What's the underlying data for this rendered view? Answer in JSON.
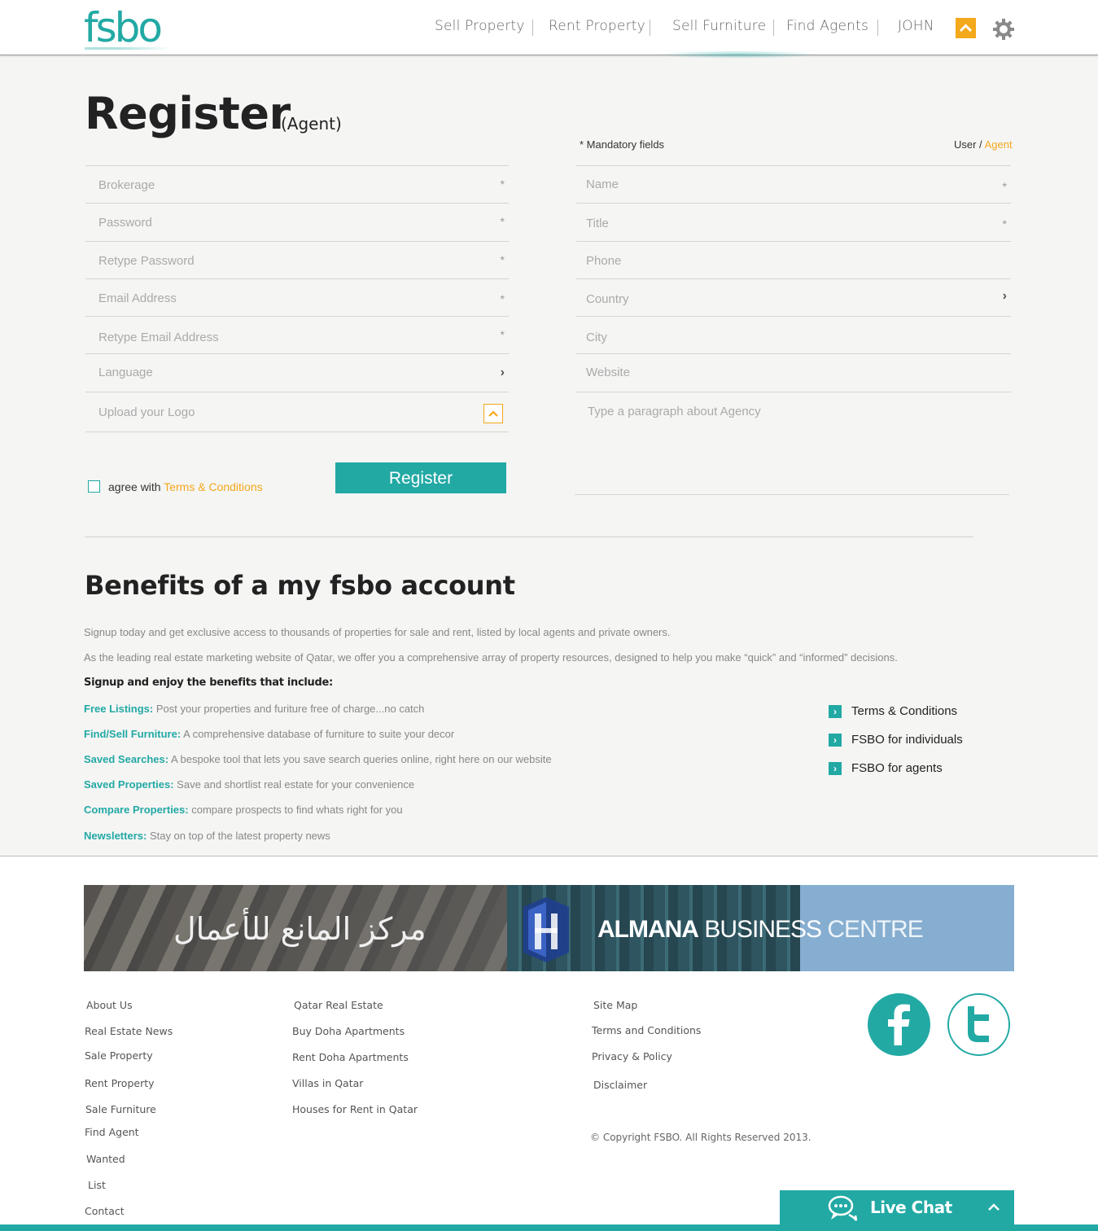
{
  "header": {
    "logo": "fsbo",
    "nav": [
      "Sell Property",
      "Rent Property",
      "Sell Furniture",
      "Find Agents"
    ],
    "user": "JOHN"
  },
  "page": {
    "title": "Register",
    "subtitle": "(Agent)",
    "mandatory": "* Mandatory fields",
    "user_label": "User /",
    "agent_label": "Agent"
  },
  "form_left": [
    {
      "placeholder": "Brokerage",
      "marker": "*"
    },
    {
      "placeholder": "Password",
      "marker": "*"
    },
    {
      "placeholder": "Retype Password",
      "marker": "*"
    },
    {
      "placeholder": "Email Address",
      "marker": "*"
    },
    {
      "placeholder": "Retype Email Address",
      "marker": "*"
    },
    {
      "placeholder": "Language",
      "marker": "›"
    },
    {
      "placeholder": "Upload your Logo",
      "marker": ""
    }
  ],
  "form_right": [
    {
      "placeholder": "Name",
      "marker": "*"
    },
    {
      "placeholder": "Title",
      "marker": "*"
    },
    {
      "placeholder": "Phone",
      "marker": ""
    },
    {
      "placeholder": "Country",
      "marker": "›"
    },
    {
      "placeholder": "City",
      "marker": ""
    },
    {
      "placeholder": "Website",
      "marker": ""
    },
    {
      "placeholder": "Type a paragraph about Agency",
      "marker": ""
    }
  ],
  "agree": {
    "prefix": "agree with",
    "link": "Terms & Conditions"
  },
  "register_button": "Register",
  "benefits": {
    "title": "Benefits of a my fsbo account",
    "intro1": "Signup today and get exclusive access to thousands of properties for sale and rent, listed by local agents and private owners.",
    "intro2": "As the leading real estate marketing website of Qatar, we offer you a comprehensive array of property resources, designed to help you make “quick” and “informed” decisions.",
    "lead": "Signup and enjoy the benefits that include:",
    "items": [
      {
        "key": "Free Listings:",
        "text": "Post your properties and furiture free of charge...no catch"
      },
      {
        "key": "Find/Sell Furniture:",
        "text": "A comprehensive database of furniture to suite your decor"
      },
      {
        "key": "Saved Searches:",
        "text": "A bespoke tool that lets you save search queries online, right here on our website"
      },
      {
        "key": "Saved Properties:",
        "text": "Save and shortlist real estate for your convenience"
      },
      {
        "key": "Compare Properties:",
        "text": "compare prospects to find whats right for you"
      },
      {
        "key": "Newsletters:",
        "text": "Stay on top of the latest property news"
      }
    ],
    "side_links": [
      "Terms & Conditions",
      "FSBO for individuals",
      "FSBO for agents"
    ]
  },
  "banner": {
    "arabic": "مركز المانع للأعمال",
    "name_bold": "ALMANA",
    "name_mid": "BUSINESS",
    "name_light": "CENTRE"
  },
  "footer": {
    "col1": [
      "About Us",
      "Real Estate News",
      "Sale Property",
      "Rent Property",
      "Sale Furniture",
      "Find Agent",
      "Wanted",
      "List",
      "Contact"
    ],
    "col2": [
      "Qatar Real Estate",
      "Buy Doha Apartments",
      "Rent Doha Apartments",
      "Villas in Qatar",
      "Houses for Rent in Qatar"
    ],
    "col3": [
      "Site Map",
      "Terms and Conditions",
      "Privacy & Policy",
      "Disclaimer"
    ],
    "copyright": "© Copyright FSBO. All Rights Reserved 2013."
  },
  "livechat": "Live Chat",
  "colors": {
    "accent": "#22a9a4",
    "highlight": "#f4a81b"
  }
}
